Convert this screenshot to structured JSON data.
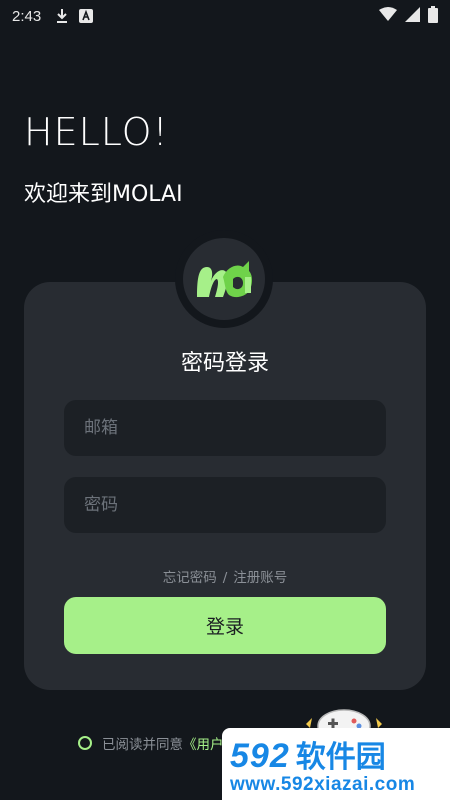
{
  "status_bar": {
    "time": "2:43",
    "icons": [
      "download-icon",
      "keyboard-a-icon"
    ],
    "right_icons": [
      "wifi-icon",
      "signal-icon",
      "battery-icon"
    ]
  },
  "header": {
    "greeting": "HELLO!",
    "welcome": "欢迎来到MOLAI"
  },
  "card": {
    "title": "密码登录",
    "email_placeholder": "邮箱",
    "password_placeholder": "密码",
    "forgot_password": "忘记密码",
    "separator": "/",
    "register": "注册账号",
    "login_button": "登录"
  },
  "agreement": {
    "prefix": "已阅读并同意",
    "link": "《用户"
  },
  "watermark": {
    "number": "592",
    "text": "软件园",
    "url": "www.592xiazai.com"
  },
  "colors": {
    "accent": "#a6f089",
    "background": "#13171c",
    "card": "#282c32",
    "input": "#1c2025",
    "watermark_blue": "#1787e5"
  }
}
